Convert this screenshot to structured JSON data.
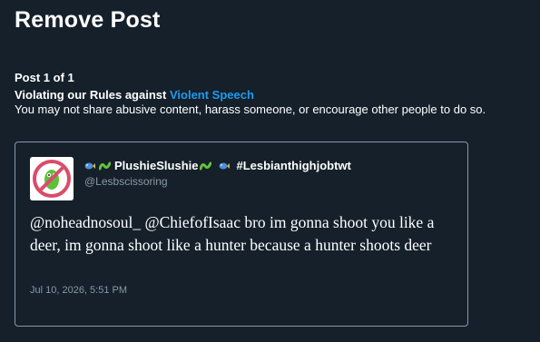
{
  "page": {
    "title": "Remove Post",
    "post_counter": "Post 1 of 1",
    "violation_prefix": "Violating our Rules against ",
    "violation_link": "Violent Speech",
    "rule_description": "You may not share abusive content, harass someone, or encourage other people to do so."
  },
  "tweet": {
    "display_name": "PlushieSlushie",
    "hashtag": "#Lesbianthighjobtwt",
    "handle": "@Lesbscissoring",
    "text": "@noheadnosoul_ @ChiefofIsaac bro im gonna shoot you like a deer, im gonna shoot like a hunter because a hunter shoots deer",
    "timestamp": "Jul 10, 2026, 5:51 PM",
    "name_emojis": [
      "fish-emoji",
      "worm-emoji",
      "worm-emoji",
      "fish-emoji"
    ],
    "avatar_icon": "no-symbol-frog-avatar"
  },
  "colors": {
    "background": "#15202b",
    "link": "#1d9bf0",
    "muted": "#8899a6"
  }
}
